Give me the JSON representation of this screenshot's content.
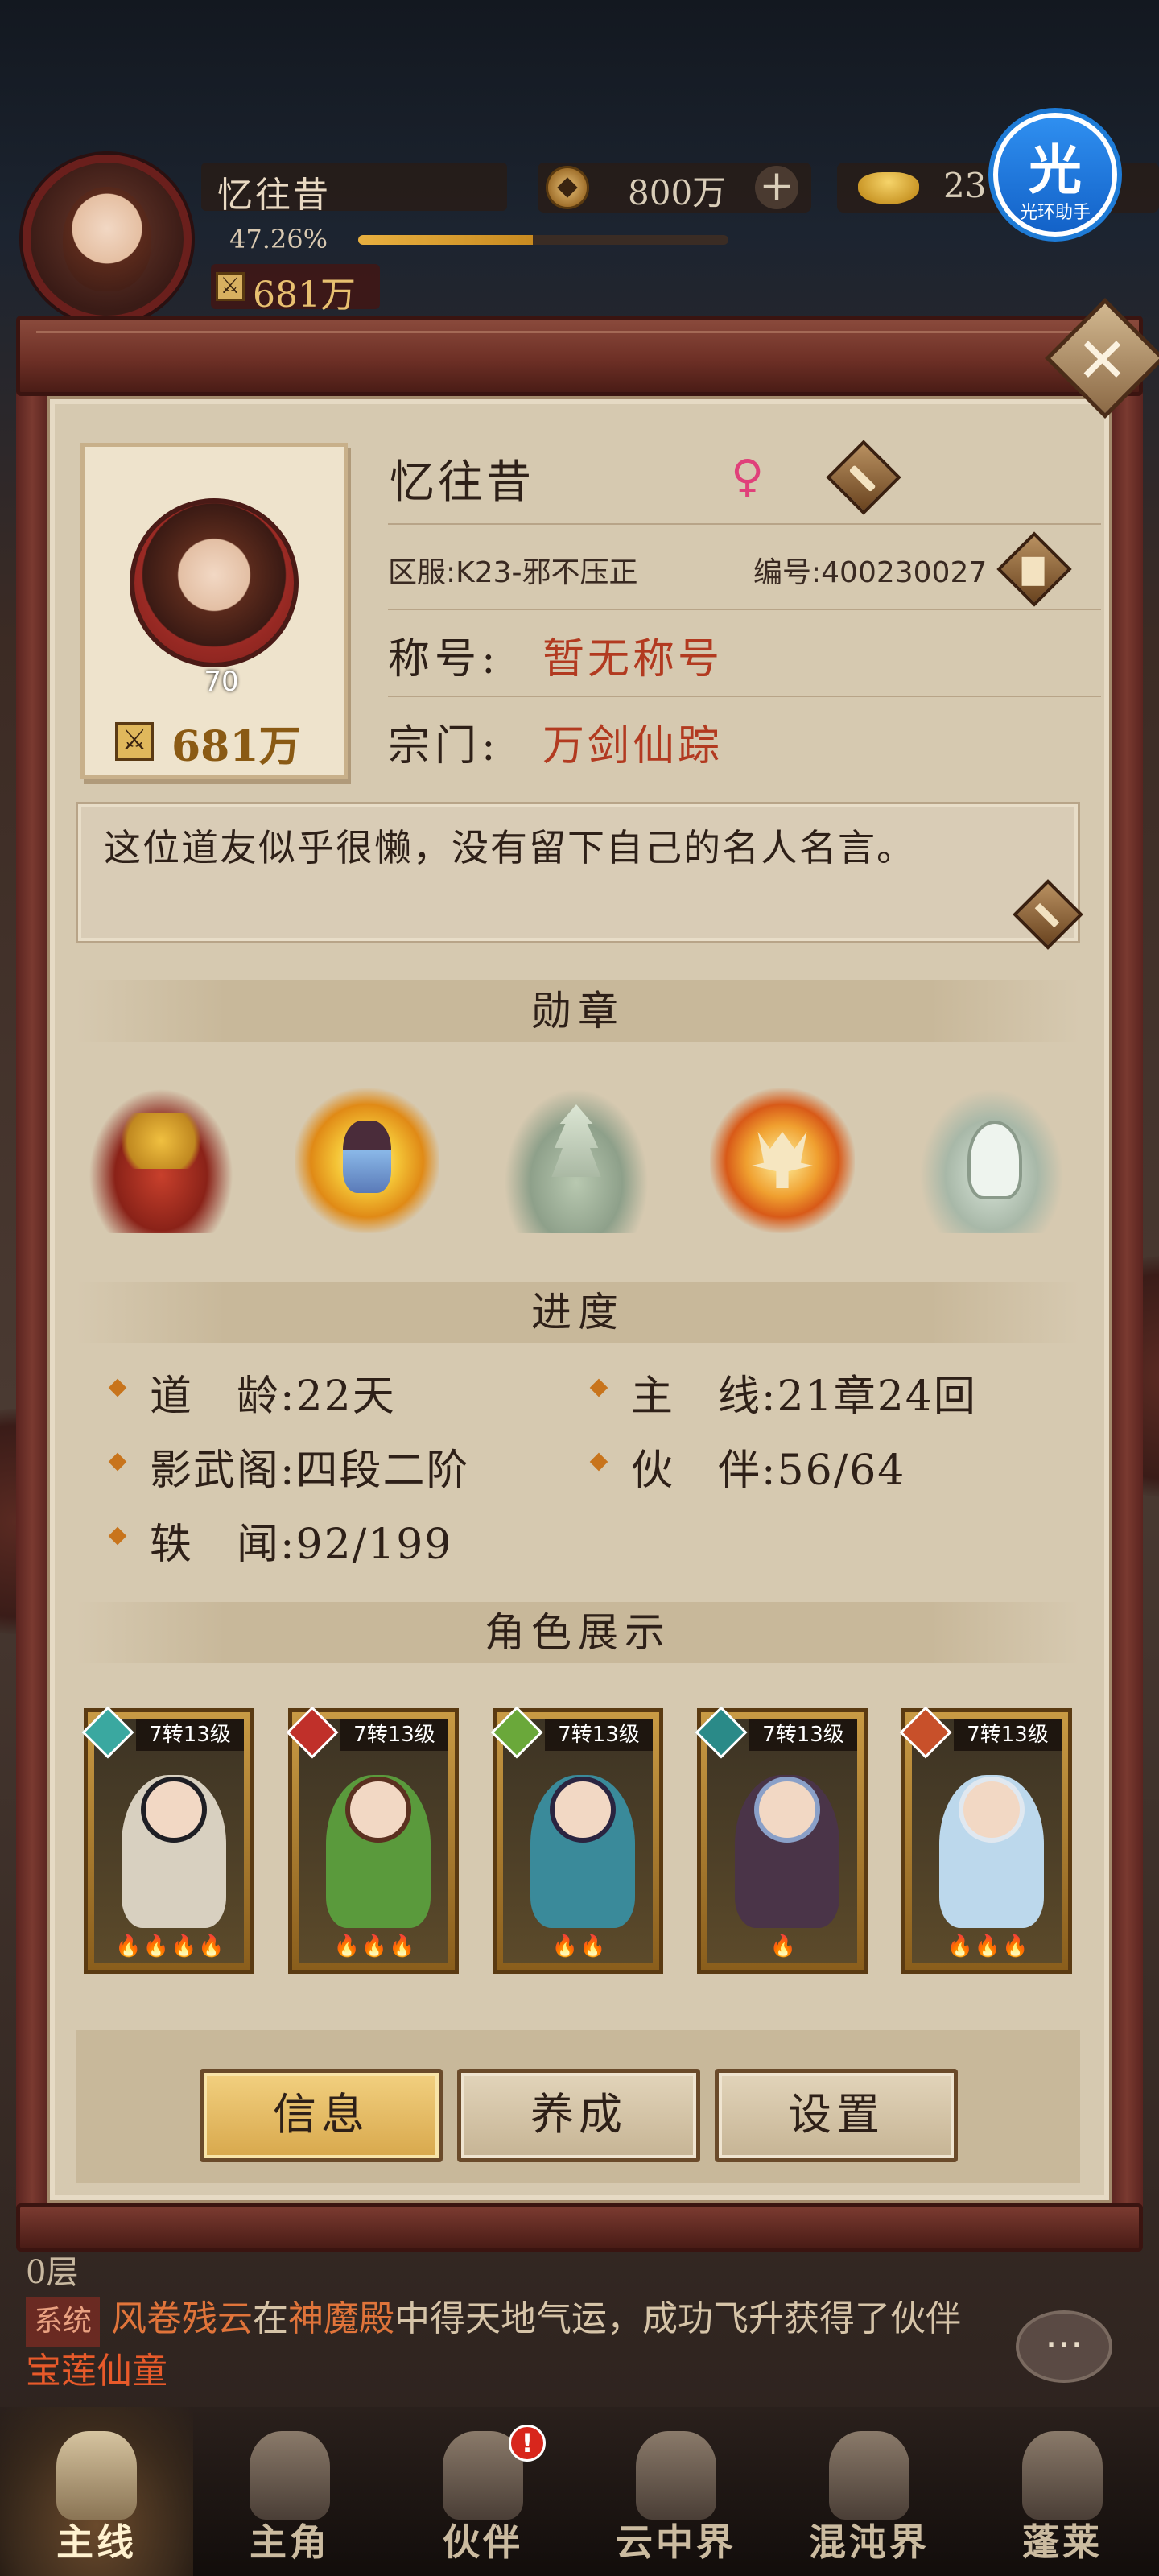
{
  "topbar": {
    "player_name": "忆往昔",
    "exp_percent": "47.26%",
    "exp_fraction": 0.4726,
    "avatar_level": "70",
    "power": "681万",
    "power_icon": "crossed-swords-icon",
    "copper": "800万",
    "gold": "23",
    "helper_glyph": "光",
    "helper_label": "光环助手"
  },
  "profile": {
    "name": "忆往昔",
    "gender_symbol": "♀",
    "server": "区服:K23-邪不压正",
    "serial": "编号:400230027",
    "level": "70",
    "power": "681万",
    "title_label": "称号:",
    "title_value": "暂无称号",
    "sect_label": "宗门:",
    "sect_value": "万剑仙踪",
    "motto": "这位道友似乎很懒，没有留下自己的名人名言。"
  },
  "sections": {
    "medals": "勋章",
    "progress": "进度",
    "characters": "角色展示"
  },
  "medals": [
    "treasure-chest-medal-icon",
    "golden-meditation-medal-icon",
    "jade-pagoda-medal-icon",
    "flame-demon-medal-icon",
    "jade-lotus-medal-icon"
  ],
  "progress": {
    "dao_age": "道　龄:22天",
    "main_line": "主　线:21章24回",
    "shadow_pavilion": "影武阁:四段二阶",
    "partners": "伙　伴:56/64",
    "anecdotes": "轶　闻:92/199"
  },
  "characters": [
    {
      "level": "7转13级",
      "stars": "🔥🔥🔥🔥",
      "elem_color": "#3aa8a0",
      "hair": "#1e1e24",
      "outfit": "#d8d0c0"
    },
    {
      "level": "7转13级",
      "stars": "🔥🔥🔥",
      "elem_color": "#c0302a",
      "hair": "#5a3020",
      "outfit": "#5a9a3c"
    },
    {
      "level": "7转13级",
      "stars": "🔥🔥",
      "elem_color": "#6aa83a",
      "hair": "#2a2440",
      "outfit": "#3a8a9a"
    },
    {
      "level": "7转13级",
      "stars": "🔥",
      "elem_color": "#2a8a88",
      "hair": "#8aa0c8",
      "outfit": "#4a3448"
    },
    {
      "level": "7转13级",
      "stars": "🔥🔥🔥",
      "elem_color": "#c8502a",
      "hair": "#e0e8f0",
      "outfit": "#bcd8ec"
    }
  ],
  "tabs": [
    "信息",
    "养成",
    "设置"
  ],
  "chat": {
    "floor": "0层",
    "system_tag": "系统",
    "msg_part1": "风卷残云",
    "msg_part2": "在",
    "msg_part3": "神魔殿",
    "msg_part4": "中得天地气运，成功飞升获得了伙伴",
    "msg_part5": "宝莲仙童"
  },
  "nav": [
    {
      "label": "主线",
      "icon": "crossed-swords-icon"
    },
    {
      "label": "主角",
      "icon": "hero-icon"
    },
    {
      "label": "伙伴",
      "icon": "partner-icon",
      "badge": "!"
    },
    {
      "label": "云中界",
      "icon": "cloud-palace-icon"
    },
    {
      "label": "混沌界",
      "icon": "chaos-realm-icon"
    },
    {
      "label": "蓬莱",
      "icon": "penglai-icon"
    }
  ],
  "colors": {
    "accent_red": "#b23a20",
    "gold": "#d8a84c",
    "paper": "#d6c9b0",
    "frame": "#6e3026"
  }
}
